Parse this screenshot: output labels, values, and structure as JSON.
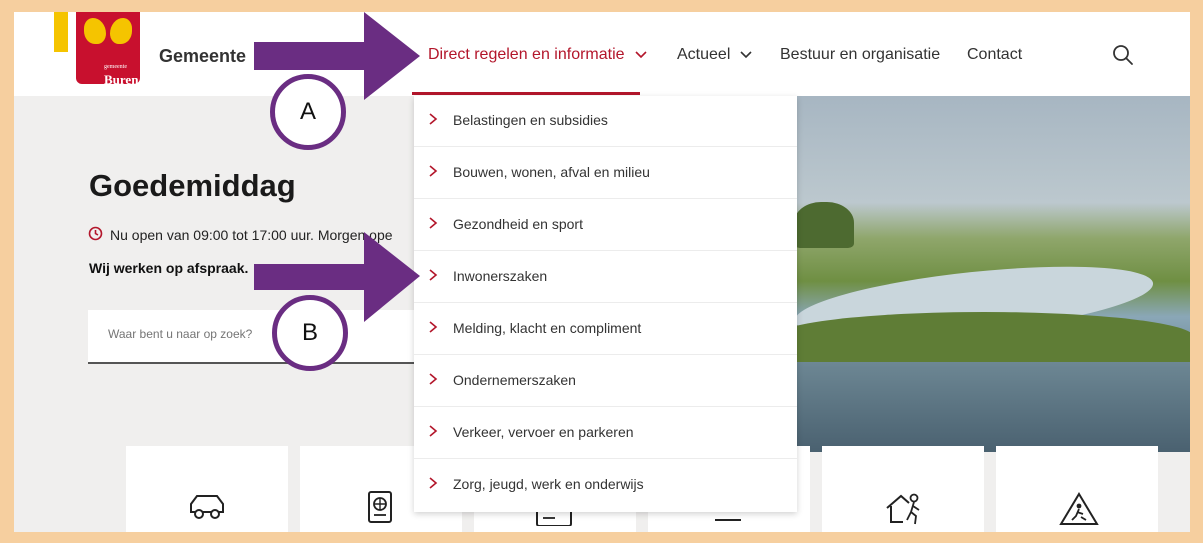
{
  "brand": {
    "name": "Gemeente",
    "logo_small": "gemeente",
    "logo_text": "Buren"
  },
  "nav": {
    "items": [
      {
        "label": "Direct regelen en informatie",
        "active": true,
        "has_dropdown": true
      },
      {
        "label": "Actueel",
        "active": false,
        "has_dropdown": true
      },
      {
        "label": "Bestuur en organisatie",
        "active": false,
        "has_dropdown": false
      },
      {
        "label": "Contact",
        "active": false,
        "has_dropdown": false
      }
    ]
  },
  "dropdown": {
    "items": [
      {
        "label": "Belastingen en subsidies"
      },
      {
        "label": "Bouwen, wonen, afval en milieu"
      },
      {
        "label": "Gezondheid en sport"
      },
      {
        "label": "Inwonerszaken"
      },
      {
        "label": "Melding, klacht en compliment"
      },
      {
        "label": "Ondernemerszaken"
      },
      {
        "label": "Verkeer, vervoer en parkeren"
      },
      {
        "label": "Zorg, jeugd, werk en onderwijs"
      }
    ]
  },
  "hero": {
    "greeting": "Goedemiddag",
    "open_text": "Nu open van 09:00 tot 17:00 uur. Morgen ope",
    "appointment": "Wij werken op afspraak.",
    "search_placeholder": "Waar bent u naar op zoek?"
  },
  "tiles": {
    "icons": [
      "car-icon",
      "passport-icon",
      "id-card-icon",
      "document-icon",
      "house-person-icon",
      "roadwork-icon"
    ]
  },
  "annotations": {
    "a_label": "A",
    "b_label": "B",
    "color": "#6a2d82"
  },
  "colors": {
    "accent": "#b3162b",
    "frame_border": "#f6cf9f",
    "annotation": "#6a2d82"
  }
}
